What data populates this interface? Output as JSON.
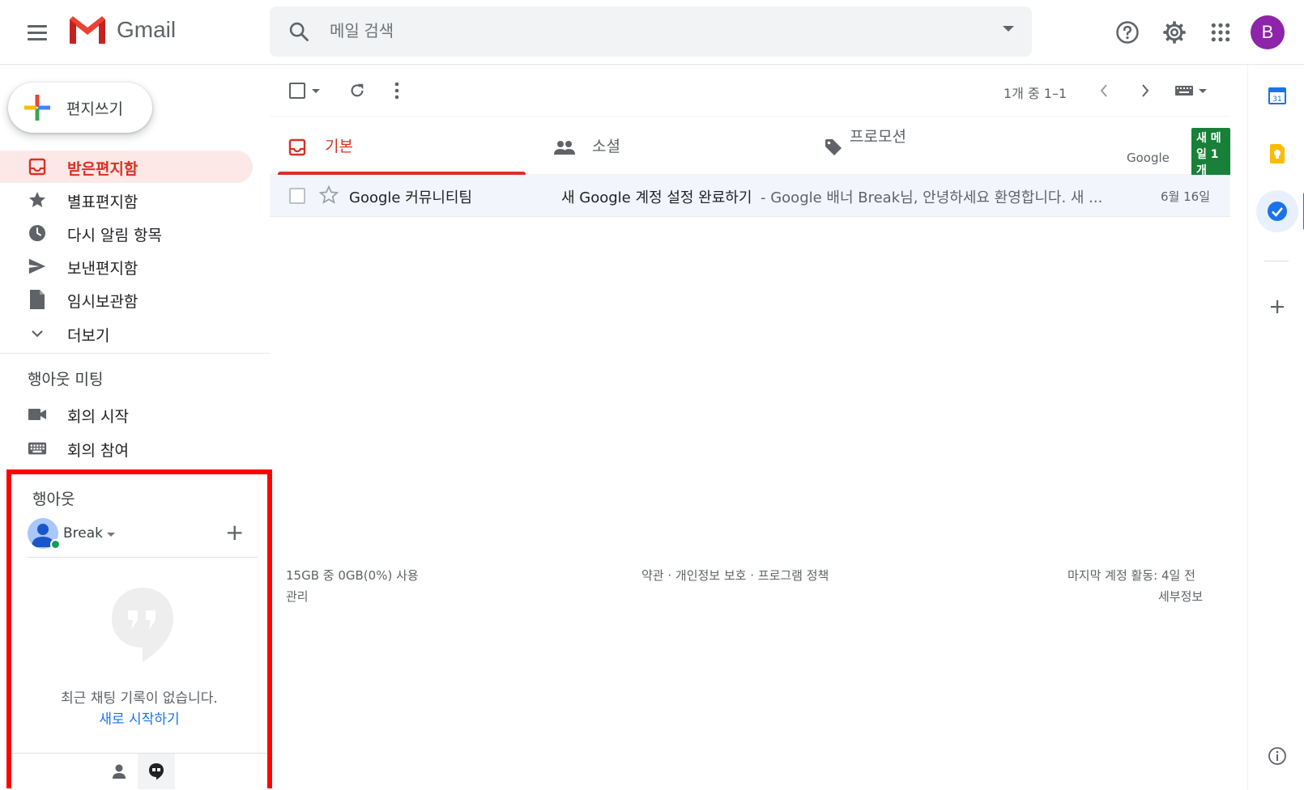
{
  "header": {
    "app_name": "Gmail",
    "search_placeholder": "메일 검색",
    "avatar_letter": "B",
    "avatar_color": "#8e24aa"
  },
  "compose": {
    "label": "편지쓰기"
  },
  "nav": {
    "items": [
      {
        "label": "받은편지함",
        "icon": "inbox-icon",
        "active": true
      },
      {
        "label": "별표편지함",
        "icon": "star-icon"
      },
      {
        "label": "다시 알림 항목",
        "icon": "clock-icon"
      },
      {
        "label": "보낸편지함",
        "icon": "send-icon"
      },
      {
        "label": "임시보관함",
        "icon": "draft-icon"
      },
      {
        "label": "더보기",
        "icon": "chevron-down-icon"
      }
    ]
  },
  "meet": {
    "title": "행아웃 미팅",
    "items": [
      {
        "label": "회의 시작",
        "icon": "video-camera-icon"
      },
      {
        "label": "회의 참여",
        "icon": "keyboard-icon"
      }
    ]
  },
  "hangouts": {
    "title": "행아웃",
    "user_name": "Break",
    "empty_text": "최근 채팅 기록이 없습니다.",
    "start_link": "새로 시작하기"
  },
  "toolbar": {
    "pager_text": "1개 중 1–1"
  },
  "tabs": [
    {
      "label": "기본",
      "icon": "inbox-tab-icon",
      "active": true
    },
    {
      "label": "소셜",
      "icon": "people-icon"
    },
    {
      "label": "프로모션",
      "icon": "tag-icon",
      "badge": "새 메일 1개",
      "subtitle": "Google"
    }
  ],
  "emails": [
    {
      "sender": "Google 커뮤니티팀",
      "subject": "새 Google 계정 설정 완료하기",
      "snippet": " - Google 배너 Break님, 안녕하세요 환영합니다. 새 ...",
      "date": "6월 16일"
    }
  ],
  "footer": {
    "storage": "15GB 중 0GB(0%) 사용",
    "manage": "관리",
    "policy": "약관 · 개인정보 보호 · 프로그램 정책",
    "last_activity": "마지막 계정 활동: 4일 전",
    "details": "세부정보"
  },
  "colors": {
    "accent_red": "#d93025",
    "badge_green": "#188038",
    "highlight_border": "#ff0000"
  }
}
